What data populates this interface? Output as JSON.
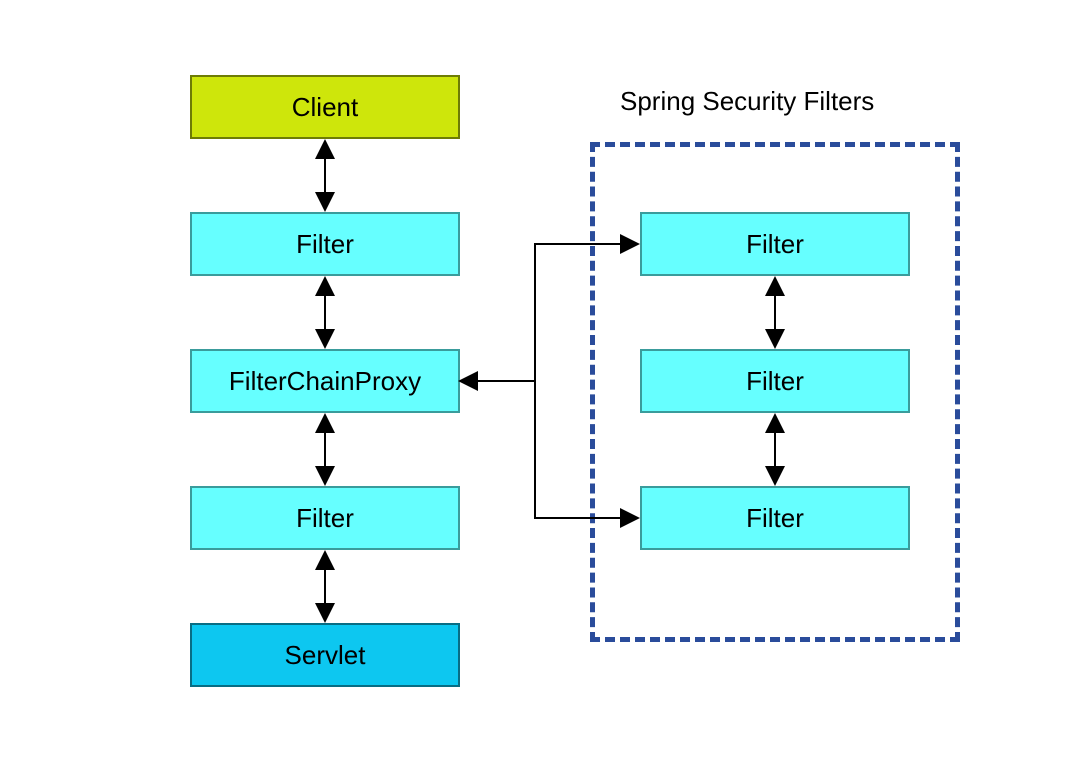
{
  "left": {
    "client": "Client",
    "filter1": "Filter",
    "proxy": "FilterChainProxy",
    "filter2": "Filter",
    "servlet": "Servlet"
  },
  "right": {
    "title": "Spring Security Filters",
    "filter1": "Filter",
    "filter2": "Filter",
    "filter3": "Filter"
  }
}
